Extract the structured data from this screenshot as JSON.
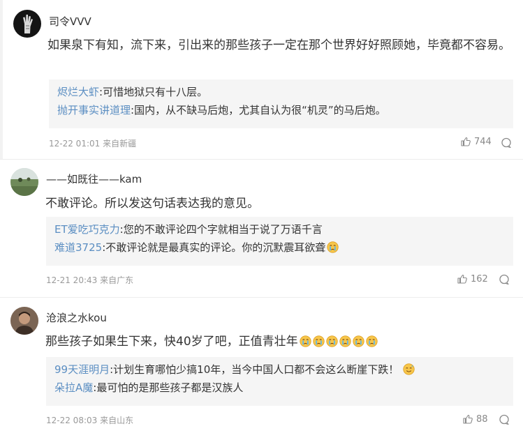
{
  "comments": [
    {
      "username": "司令VVV",
      "avatar": "skeleton-hand-avatar",
      "content": "如果泉下有知，流下来，引出来的那些孩子一定在那个世界好好照顾她，毕竟都不容易。",
      "replies": [
        {
          "user": "烬烂大虾",
          "text": ":可惜地狱只有十八层。"
        },
        {
          "user": "抛开事实讲道理",
          "text": ":国内，从不缺马后炮，尤其自认为很“机灵”的马后炮。"
        }
      ],
      "time": "12-22 01:01 来自新疆",
      "likes": "744"
    },
    {
      "username": "——如既往——kam",
      "avatar": "landscape-avatar",
      "content": "不敢评论。所以发这句话表达我的意见。",
      "replies": [
        {
          "user": "ET爱吃巧克力",
          "text": ":您的不敢评论四个字就相当于说了万语千言"
        },
        {
          "user": "难道3725",
          "text": ":不敢评论就是最真实的评论。你的沉默震耳欲聋"
        }
      ],
      "time": "12-21 20:43 来自广东",
      "likes": "162"
    },
    {
      "username": "沧浪之水kou",
      "avatar": "portrait-avatar",
      "content": "那些孩子如果生下来，快40岁了吧，正值青壮年",
      "replies": [
        {
          "user": "99天涯明月",
          "text": ":计划生育哪怕少搞10年，当今中国人口都不会这么断崖下跌！"
        },
        {
          "user": "朵拉A魔",
          "text": ":最可怕的是那些孩子都是汉族人"
        }
      ],
      "time": "12-22 08:03 来自山东",
      "likes": "88"
    }
  ],
  "colors": {
    "link": "#5b8ec2",
    "text": "#333333",
    "meta": "#999999",
    "reply_bg": "#f5f5f5"
  },
  "icons": {
    "like": "thumbs-up-icon",
    "reply": "comment-bubble-icon",
    "emoji": "crying-face-emoji"
  }
}
